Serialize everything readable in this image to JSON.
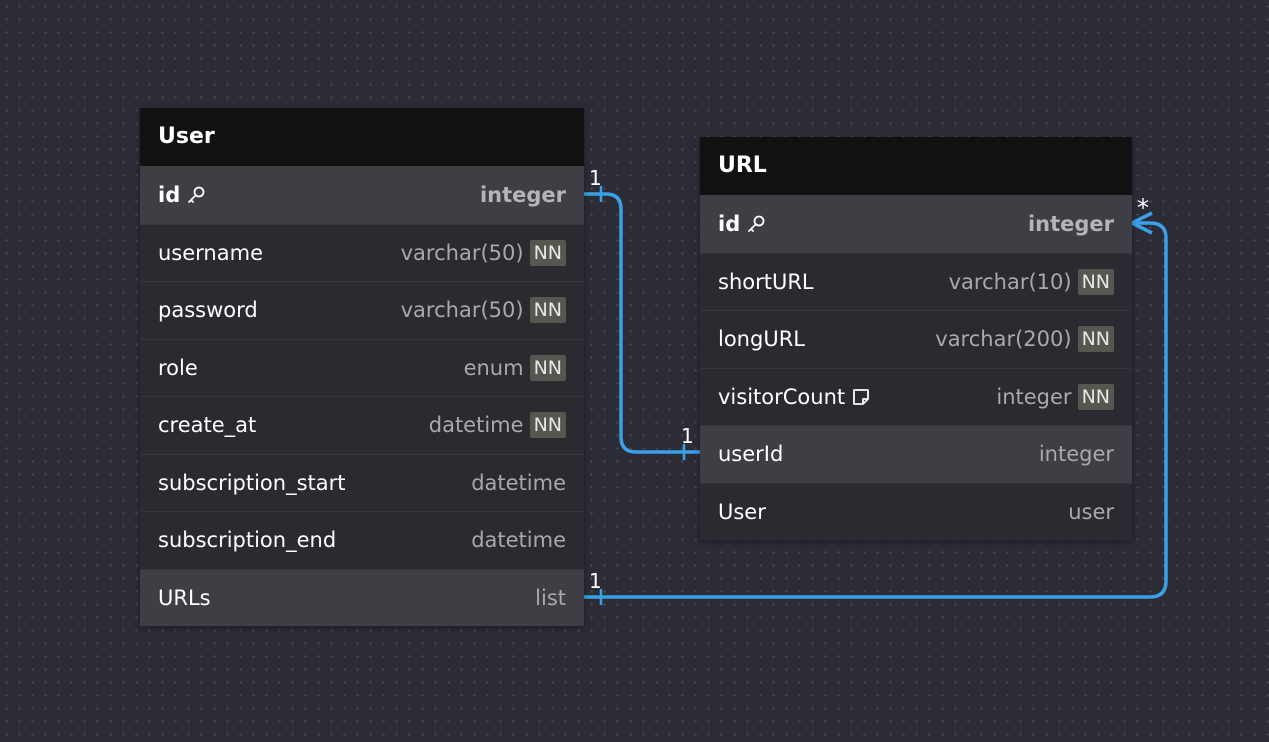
{
  "tables": [
    {
      "title": "User",
      "rows": [
        {
          "name": "id",
          "type": "integer",
          "nn": "",
          "icon": "key-icon",
          "style": "pk"
        },
        {
          "name": "username",
          "type": "varchar(50)",
          "nn": "NN",
          "icon": "",
          "style": ""
        },
        {
          "name": "password",
          "type": "varchar(50)",
          "nn": "NN",
          "icon": "",
          "style": ""
        },
        {
          "name": "role",
          "type": "enum",
          "nn": "NN",
          "icon": "",
          "style": ""
        },
        {
          "name": "create_at",
          "type": "datetime",
          "nn": "NN",
          "icon": "",
          "style": ""
        },
        {
          "name": "subscription_start",
          "type": "datetime",
          "nn": "",
          "icon": "",
          "style": ""
        },
        {
          "name": "subscription_end",
          "type": "datetime",
          "nn": "",
          "icon": "",
          "style": ""
        },
        {
          "name": "URLs",
          "type": "list",
          "nn": "",
          "icon": "",
          "style": "rel"
        }
      ]
    },
    {
      "title": "URL",
      "rows": [
        {
          "name": "id",
          "type": "integer",
          "nn": "",
          "icon": "key-icon",
          "style": "pk"
        },
        {
          "name": "shortURL",
          "type": "varchar(10)",
          "nn": "NN",
          "icon": "",
          "style": ""
        },
        {
          "name": "longURL",
          "type": "varchar(200)",
          "nn": "NN",
          "icon": "",
          "style": ""
        },
        {
          "name": "visitorCount",
          "type": "integer",
          "nn": "NN",
          "icon": "note-icon",
          "style": ""
        },
        {
          "name": "userId",
          "type": "integer",
          "nn": "",
          "icon": "",
          "style": "rel"
        },
        {
          "name": "User",
          "type": "user",
          "nn": "",
          "icon": "",
          "style": ""
        }
      ]
    }
  ],
  "relations": {
    "user_id_to_url_userid": {
      "from_card": "1",
      "to_card": "1"
    },
    "user_urls_to_url_id": {
      "from_card": "1",
      "to_card": "*"
    }
  },
  "colors": {
    "background": "#2c2c36",
    "connector": "#3aa0e8",
    "header": "#111111",
    "nn_badge": "#57574f"
  }
}
